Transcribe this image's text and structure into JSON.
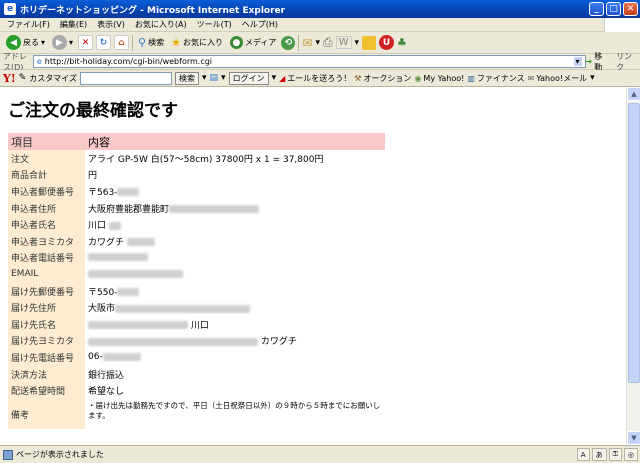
{
  "window": {
    "title": "ホリデーネットショッピング - Microsoft Internet Explorer"
  },
  "menu": [
    "ファイル(F)",
    "編集(E)",
    "表示(V)",
    "お気に入り(A)",
    "ツール(T)",
    "ヘルプ(H)"
  ],
  "toolbar": {
    "back": "戻る",
    "search": "検索",
    "favorites": "お気に入り",
    "media": "メディア"
  },
  "address": {
    "label": "アドレス(D)",
    "url": "http://bit-holiday.com/cgi-bin/webform.cgi",
    "go": "移動",
    "links": "リンク"
  },
  "yahoo_bar": {
    "logo": "Y!",
    "customize": "カスタマイズ",
    "search_button": "検索",
    "login_button": "ログイン",
    "items": [
      "エールを送ろう！",
      "オークション",
      "My Yahoo!",
      "ファイナンス",
      "Yahoo!メール"
    ]
  },
  "page": {
    "heading": "ご注文の最終確認です",
    "table_header": {
      "label": "項目",
      "value": "内容"
    },
    "rows": [
      {
        "label": "注文",
        "value": "アライ GP-5W 白(57〜58cm) 37800円 x 1 = 37,800円"
      },
      {
        "label": "商品合計",
        "value": "円"
      },
      {
        "label": "申込者郵便番号",
        "value": "〒563-"
      },
      {
        "label": "申込者住所",
        "value": "大阪府豊能郡豊能町"
      },
      {
        "label": "申込者氏名",
        "value": "川口"
      },
      {
        "label": "申込者ヨミカタ",
        "value": "カワグチ"
      },
      {
        "label": "申込者電話番号",
        "value": ""
      },
      {
        "label": "EMAIL",
        "value": ""
      },
      {
        "label": "届け先郵便番号",
        "value": "〒550-"
      },
      {
        "label": "届け先住所",
        "value": "大阪市"
      },
      {
        "label": "届け先氏名",
        "value": "川口"
      },
      {
        "label": "届け先ヨミカタ",
        "value": "カワグチ"
      },
      {
        "label": "届け先電話番号",
        "value": "06-"
      },
      {
        "label": "決済方法",
        "value": "銀行振込"
      },
      {
        "label": "配送希望時間",
        "value": "希望なし"
      }
    ],
    "note": {
      "label": "備考",
      "value": "・届け出先は勤務先ですので、平日（土日祝祭日以外）の９時から５時までにお願いします。"
    }
  },
  "status": {
    "text": "ページが表示されました"
  },
  "colors": {
    "header_row": "#f9c8c8",
    "label_cell": "#fdecd2",
    "titlebar": "#0842b0"
  }
}
